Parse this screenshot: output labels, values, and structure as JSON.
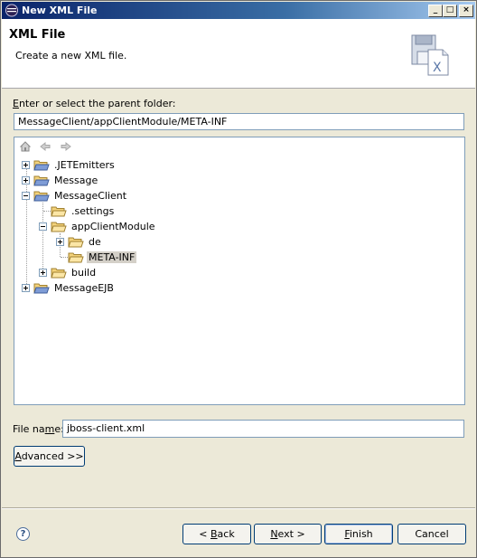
{
  "window": {
    "title": "New XML File",
    "controls": {
      "minimize": "_",
      "maximize": "□",
      "close": "×"
    }
  },
  "banner": {
    "heading": "XML File",
    "description": "Create a new XML file."
  },
  "parent_folder": {
    "label_prefix": "",
    "label_mnemonic": "E",
    "label_rest": "nter or select the parent folder:",
    "value": "MessageClient/appClientModule/META-INF"
  },
  "tree": {
    "toolbar": {
      "home": "home-icon",
      "back": "back-arrow-icon",
      "forward": "forward-arrow-icon"
    },
    "nodes": [
      {
        "label": ".JETEmitters",
        "icon": "project-icon",
        "expander": "plus"
      },
      {
        "label": "Message",
        "icon": "project-icon",
        "expander": "plus"
      },
      {
        "label": "MessageClient",
        "icon": "project-icon",
        "expander": "minus"
      },
      {
        "label": ".settings",
        "icon": "folder-icon",
        "expander": "none"
      },
      {
        "label": "appClientModule",
        "icon": "folder-icon",
        "expander": "minus"
      },
      {
        "label": "de",
        "icon": "folder-icon",
        "expander": "plus"
      },
      {
        "label": "META-INF",
        "icon": "folder-icon",
        "expander": "none",
        "selected": true
      },
      {
        "label": "build",
        "icon": "folder-icon",
        "expander": "plus"
      },
      {
        "label": "MessageEJB",
        "icon": "project-icon",
        "expander": "plus"
      }
    ]
  },
  "file_name": {
    "label_prefix": "File na",
    "label_mnemonic": "m",
    "label_rest": "e:",
    "value": "jboss-client.xml"
  },
  "advanced_button": {
    "mnemonic": "A",
    "rest": "dvanced >>"
  },
  "footer": {
    "help": "?",
    "back": {
      "prefix": "< ",
      "mnemonic": "B",
      "rest": "ack"
    },
    "next": {
      "mnemonic": "N",
      "rest": "ext >"
    },
    "finish": {
      "mnemonic": "F",
      "rest": "inish"
    },
    "cancel": "Cancel"
  },
  "colors": {
    "title_bar": "#0a246a",
    "selection": "#d4d0c8",
    "field_border": "#7f9db9",
    "button_border": "#003c74"
  }
}
